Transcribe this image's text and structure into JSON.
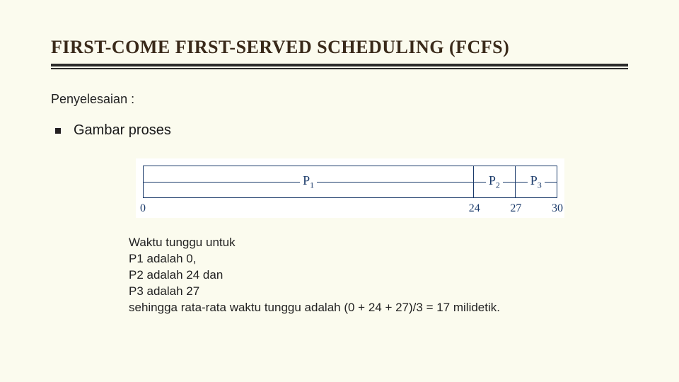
{
  "title": "FIRST-COME FIRST-SERVED SCHEDULING (FCFS)",
  "subtitle": "Penyelesaian :",
  "bullet_label": "Gambar proses",
  "chart_data": {
    "type": "bar",
    "title": "",
    "xlabel": "",
    "ylabel": "",
    "segments": [
      {
        "label_base": "P",
        "label_sub": "1",
        "start": 0,
        "end": 24
      },
      {
        "label_base": "P",
        "label_sub": "2",
        "start": 24,
        "end": 27
      },
      {
        "label_base": "P",
        "label_sub": "3",
        "start": 27,
        "end": 30
      }
    ],
    "ticks": [
      0,
      24,
      27,
      30
    ],
    "xlim": [
      0,
      30
    ]
  },
  "notes": {
    "l1": "Waktu tunggu untuk",
    "l2": "P1 adalah 0,",
    "l3": "P2 adalah 24 dan",
    "l4": "P3 adalah 27",
    "l5": "sehingga rata-rata waktu tunggu adalah (0 + 24 + 27)/3 = 17 milidetik."
  }
}
